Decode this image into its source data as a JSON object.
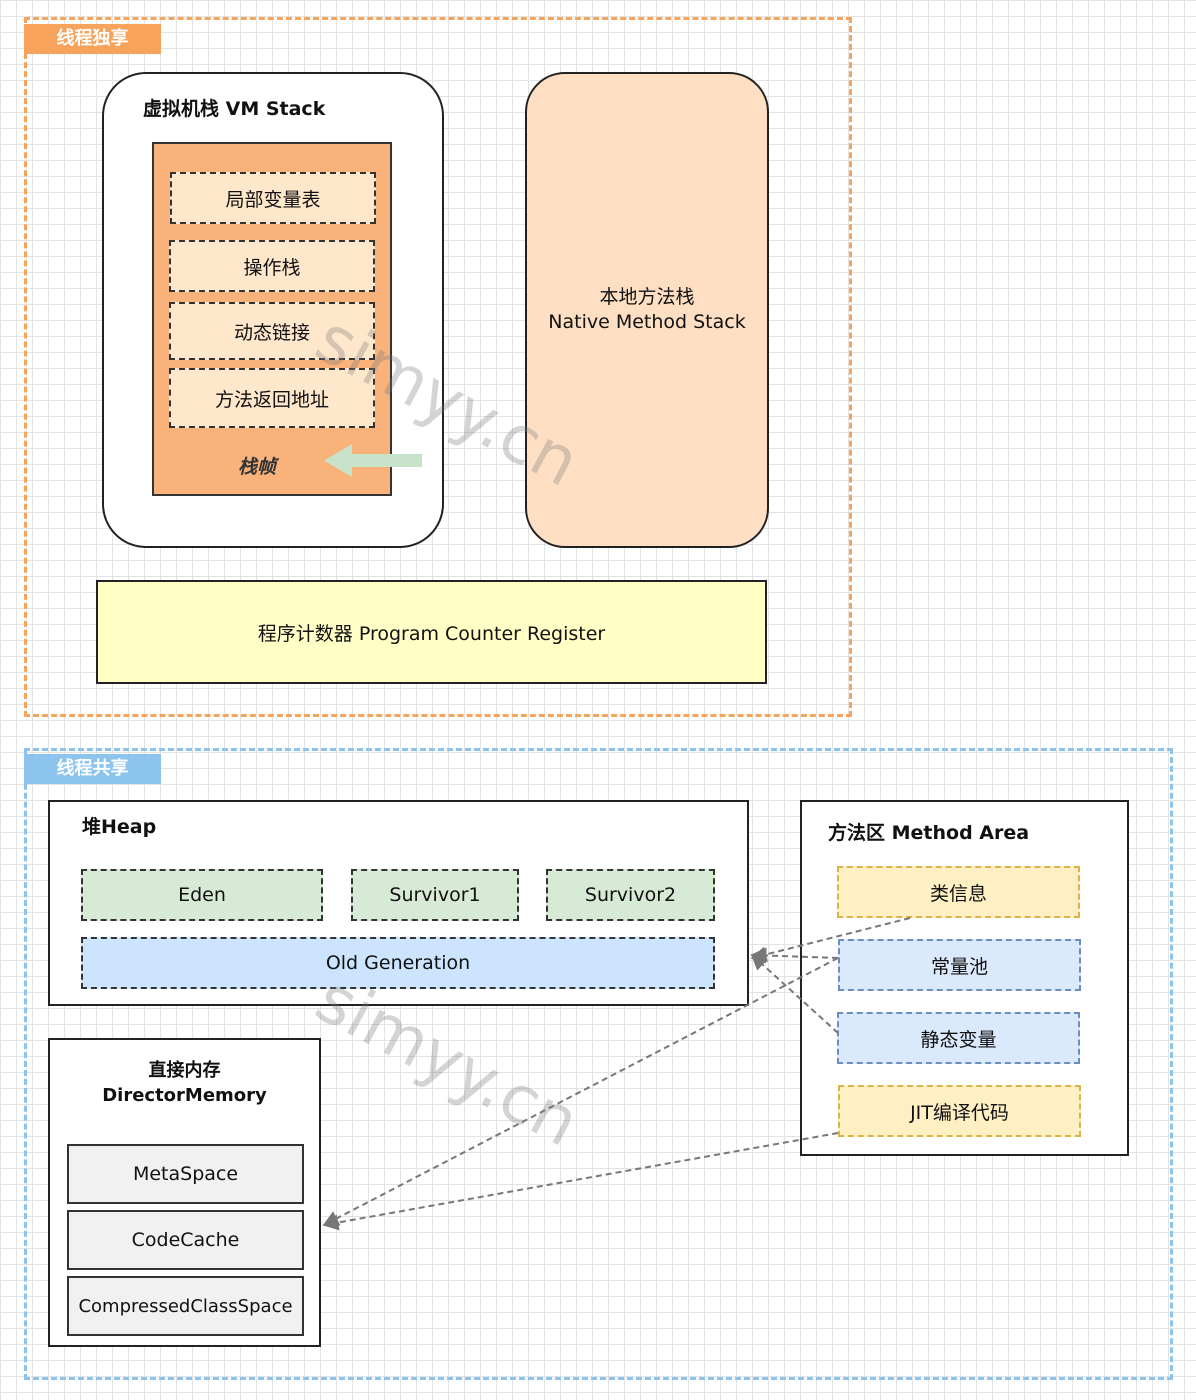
{
  "thread_private": {
    "tag": "线程独享",
    "vm_stack": {
      "title": "虚拟机栈 VM Stack",
      "items": [
        "局部变量表",
        "操作栈",
        "动态链接",
        "方法返回地址"
      ],
      "frame_label": "栈帧"
    },
    "native_stack": {
      "line1": "本地方法栈",
      "line2": "Native Method Stack"
    },
    "pc_register": "程序计数器 Program Counter Register"
  },
  "thread_shared": {
    "tag": "线程共享",
    "heap": {
      "title": "堆Heap",
      "eden": "Eden",
      "survivor1": "Survivor1",
      "survivor2": "Survivor2",
      "old_gen": "Old Generation"
    },
    "method_area": {
      "title": "方法区 Method Area",
      "items": [
        "类信息",
        "常量池",
        "静态变量",
        "JIT编译代码"
      ]
    },
    "direct_memory": {
      "title1": "直接内存",
      "title2": "DirectorMemory",
      "items": [
        "MetaSpace",
        "CodeCache",
        "CompressedClassSpace"
      ]
    }
  },
  "watermark": "simyy.cn",
  "colors": {
    "private_accent": "#f7a35c",
    "shared_accent": "#8cc4ee",
    "stack_frame": "#f8b27a",
    "native_stack": "#ffdfc4",
    "pc_register": "#ffffc6",
    "heap_young": "#d6ead6",
    "old_gen": "#cde4ff",
    "class_info": "#fff0c4",
    "constant_pool": "#dbe9fc",
    "arrow_green": "#c7e3c9"
  }
}
